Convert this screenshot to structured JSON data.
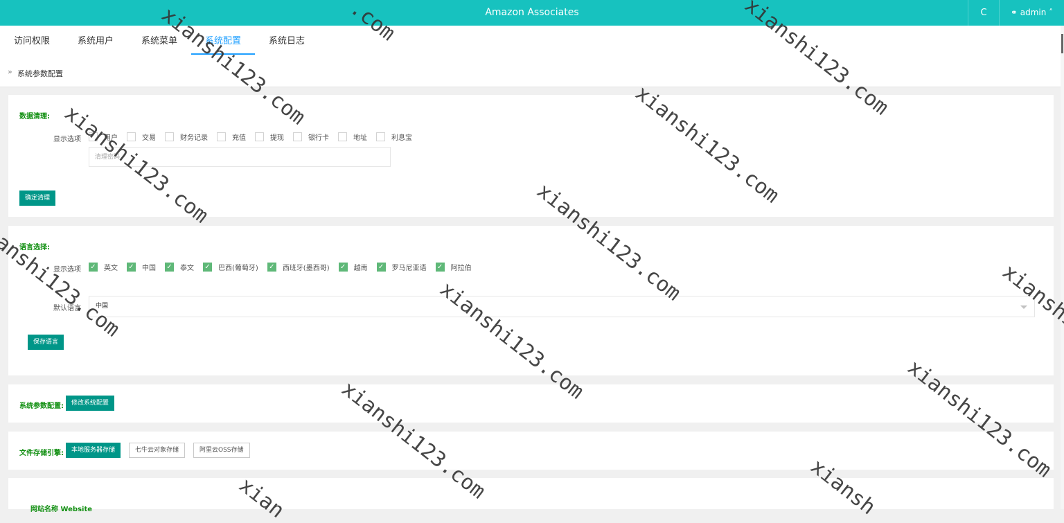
{
  "header": {
    "title": "Amazon Associates",
    "refresh_icon": "C",
    "user_label": "admin"
  },
  "tabs": [
    {
      "label": "访问权限"
    },
    {
      "label": "系统用户"
    },
    {
      "label": "系统菜单"
    },
    {
      "label": "系统配置"
    },
    {
      "label": "系统日志"
    }
  ],
  "breadcrumb": {
    "text": "系统参数配置"
  },
  "data_cleanup": {
    "title": "数据清理:",
    "options_label": "显示选项",
    "options": [
      "用户",
      "交易",
      "财务记录",
      "充值",
      "提现",
      "银行卡",
      "地址",
      "利息宝"
    ],
    "input_placeholder": "清理密码",
    "confirm_button": "确定清理"
  },
  "language": {
    "title": "语言选择:",
    "options_label": "显示选项",
    "options": [
      "英文",
      "中国",
      "泰文",
      "巴西(葡萄牙)",
      "西班牙(墨西哥)",
      "越南",
      "罗马尼亚语",
      "阿拉伯"
    ],
    "default_label": "默认语言",
    "default_value": "中国",
    "save_button": "保存语言"
  },
  "sys_params": {
    "title": "系统参数配置:",
    "edit_button": "修改系统配置"
  },
  "storage": {
    "title": "文件存储引擎:",
    "options": [
      "本地服务器存储",
      "七牛云对象存储",
      "阿里云OSS存储"
    ]
  },
  "website": {
    "title": "网站名称 Website"
  },
  "watermark": {
    "text": "xianshi123.com",
    "fragment": ".com",
    "fragment2": "xian",
    "fragment3": "xiansh"
  },
  "colors": {
    "header": "#17c2bf",
    "primary_button": "#009688",
    "section_title": "#118f11",
    "active_tab": "#1e9fff",
    "checkbox": "#5fb878"
  }
}
